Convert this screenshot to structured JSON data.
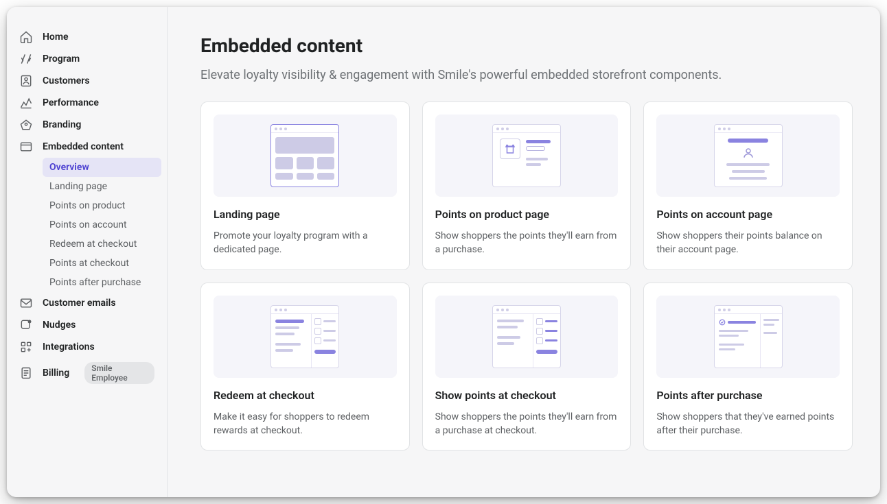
{
  "sidebar": {
    "nav": [
      {
        "id": "home",
        "label": "Home",
        "icon": "home-icon"
      },
      {
        "id": "program",
        "label": "Program",
        "icon": "program-icon"
      },
      {
        "id": "customers",
        "label": "Customers",
        "icon": "customers-icon"
      },
      {
        "id": "performance",
        "label": "Performance",
        "icon": "performance-icon"
      },
      {
        "id": "branding",
        "label": "Branding",
        "icon": "branding-icon"
      },
      {
        "id": "embedded",
        "label": "Embedded content",
        "icon": "embedded-icon"
      },
      {
        "id": "emails",
        "label": "Customer emails",
        "icon": "emails-icon"
      },
      {
        "id": "nudges",
        "label": "Nudges",
        "icon": "nudges-icon"
      },
      {
        "id": "integrations",
        "label": "Integrations",
        "icon": "integrations-icon"
      },
      {
        "id": "billing",
        "label": "Billing",
        "icon": "billing-icon",
        "badge": "Smile Employee"
      }
    ],
    "embedded_sub": [
      {
        "id": "overview",
        "label": "Overview",
        "active": true
      },
      {
        "id": "landing",
        "label": "Landing page"
      },
      {
        "id": "points-product",
        "label": "Points on product"
      },
      {
        "id": "points-account",
        "label": "Points on account"
      },
      {
        "id": "redeem-checkout",
        "label": "Redeem at checkout"
      },
      {
        "id": "points-checkout",
        "label": "Points at checkout"
      },
      {
        "id": "points-after",
        "label": "Points after purchase"
      }
    ]
  },
  "page": {
    "title": "Embedded content",
    "subtitle": "Elevate loyalty visibility & engagement with Smile's powerful embedded storefront components."
  },
  "cards": [
    {
      "id": "landing",
      "title": "Landing page",
      "desc": "Promote your loyalty program with a dedicated page."
    },
    {
      "id": "points-product",
      "title": "Points on product page",
      "desc": "Show shoppers the points they'll earn from a purchase."
    },
    {
      "id": "points-account",
      "title": "Points on account page",
      "desc": "Show shoppers their points balance on their account page."
    },
    {
      "id": "redeem-checkout",
      "title": "Redeem at checkout",
      "desc": "Make it easy for shoppers to redeem rewards at checkout."
    },
    {
      "id": "points-checkout",
      "title": "Show points at checkout",
      "desc": "Show shoppers the points they'll earn from a purchase at checkout."
    },
    {
      "id": "points-after",
      "title": "Points after purchase",
      "desc": "Show shoppers that they've earned points after their purchase."
    }
  ],
  "colors": {
    "accent": "#5c4bff",
    "accent_light": "#8a83e0",
    "illo_bg": "#f5f5fa",
    "text_primary": "#202223",
    "text_secondary": "#6d7175"
  }
}
